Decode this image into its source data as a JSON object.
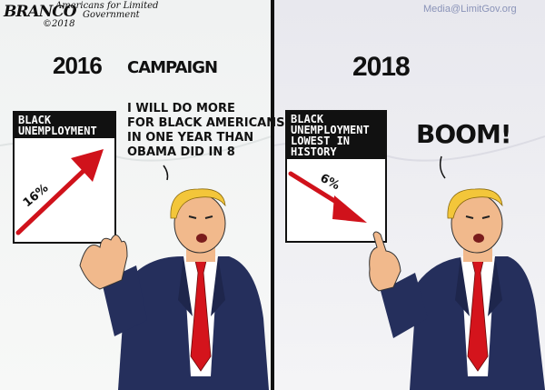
{
  "signature": {
    "name": "BRANCO",
    "org_line1": "Americans for Limited",
    "org_line2": "Government",
    "year": "©2018"
  },
  "watermark": "Media@LimitGov.org",
  "left_panel": {
    "header_year": "2016",
    "header_word": "CAMPAIGN",
    "chart": {
      "title_line1": "BLACK",
      "title_line2": "UNEMPLOYMENT",
      "label": "16%",
      "trend": "up"
    },
    "speech_lines": [
      "I WILL DO MORE",
      "FOR BLACK AMERICANS",
      "IN ONE YEAR THAN",
      "OBAMA DID IN 8"
    ]
  },
  "right_panel": {
    "header": "2018",
    "chart": {
      "title_line1": "BLACK",
      "title_line2": "UNEMPLOYMENT",
      "title_line3": "LOWEST IN",
      "title_line4": "HISTORY",
      "label": "6%",
      "trend": "down"
    },
    "exclamation": "BOOM!"
  },
  "colors": {
    "arrow_red": "#d0121b",
    "suit_navy": "#252f5c",
    "tie_red": "#d4141c",
    "hair_yellow": "#f3c63a",
    "skin": "#f1b98c"
  }
}
